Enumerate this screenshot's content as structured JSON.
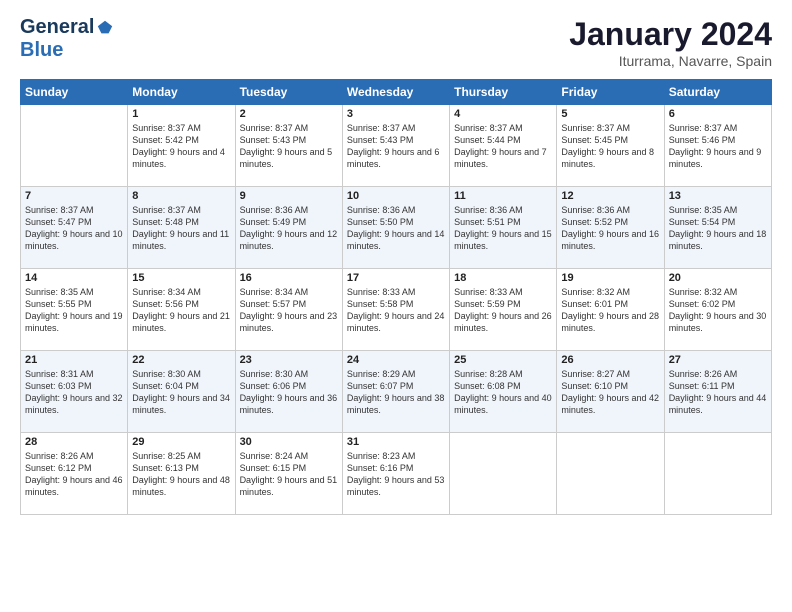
{
  "header": {
    "logo_line1": "General",
    "logo_line2": "Blue",
    "month": "January 2024",
    "location": "Iturrama, Navarre, Spain"
  },
  "weekdays": [
    "Sunday",
    "Monday",
    "Tuesday",
    "Wednesday",
    "Thursday",
    "Friday",
    "Saturday"
  ],
  "weeks": [
    [
      {
        "day": "",
        "sunrise": "",
        "sunset": "",
        "daylight": ""
      },
      {
        "day": "1",
        "sunrise": "Sunrise: 8:37 AM",
        "sunset": "Sunset: 5:42 PM",
        "daylight": "Daylight: 9 hours and 4 minutes."
      },
      {
        "day": "2",
        "sunrise": "Sunrise: 8:37 AM",
        "sunset": "Sunset: 5:43 PM",
        "daylight": "Daylight: 9 hours and 5 minutes."
      },
      {
        "day": "3",
        "sunrise": "Sunrise: 8:37 AM",
        "sunset": "Sunset: 5:43 PM",
        "daylight": "Daylight: 9 hours and 6 minutes."
      },
      {
        "day": "4",
        "sunrise": "Sunrise: 8:37 AM",
        "sunset": "Sunset: 5:44 PM",
        "daylight": "Daylight: 9 hours and 7 minutes."
      },
      {
        "day": "5",
        "sunrise": "Sunrise: 8:37 AM",
        "sunset": "Sunset: 5:45 PM",
        "daylight": "Daylight: 9 hours and 8 minutes."
      },
      {
        "day": "6",
        "sunrise": "Sunrise: 8:37 AM",
        "sunset": "Sunset: 5:46 PM",
        "daylight": "Daylight: 9 hours and 9 minutes."
      }
    ],
    [
      {
        "day": "7",
        "sunrise": "Sunrise: 8:37 AM",
        "sunset": "Sunset: 5:47 PM",
        "daylight": "Daylight: 9 hours and 10 minutes."
      },
      {
        "day": "8",
        "sunrise": "Sunrise: 8:37 AM",
        "sunset": "Sunset: 5:48 PM",
        "daylight": "Daylight: 9 hours and 11 minutes."
      },
      {
        "day": "9",
        "sunrise": "Sunrise: 8:36 AM",
        "sunset": "Sunset: 5:49 PM",
        "daylight": "Daylight: 9 hours and 12 minutes."
      },
      {
        "day": "10",
        "sunrise": "Sunrise: 8:36 AM",
        "sunset": "Sunset: 5:50 PM",
        "daylight": "Daylight: 9 hours and 14 minutes."
      },
      {
        "day": "11",
        "sunrise": "Sunrise: 8:36 AM",
        "sunset": "Sunset: 5:51 PM",
        "daylight": "Daylight: 9 hours and 15 minutes."
      },
      {
        "day": "12",
        "sunrise": "Sunrise: 8:36 AM",
        "sunset": "Sunset: 5:52 PM",
        "daylight": "Daylight: 9 hours and 16 minutes."
      },
      {
        "day": "13",
        "sunrise": "Sunrise: 8:35 AM",
        "sunset": "Sunset: 5:54 PM",
        "daylight": "Daylight: 9 hours and 18 minutes."
      }
    ],
    [
      {
        "day": "14",
        "sunrise": "Sunrise: 8:35 AM",
        "sunset": "Sunset: 5:55 PM",
        "daylight": "Daylight: 9 hours and 19 minutes."
      },
      {
        "day": "15",
        "sunrise": "Sunrise: 8:34 AM",
        "sunset": "Sunset: 5:56 PM",
        "daylight": "Daylight: 9 hours and 21 minutes."
      },
      {
        "day": "16",
        "sunrise": "Sunrise: 8:34 AM",
        "sunset": "Sunset: 5:57 PM",
        "daylight": "Daylight: 9 hours and 23 minutes."
      },
      {
        "day": "17",
        "sunrise": "Sunrise: 8:33 AM",
        "sunset": "Sunset: 5:58 PM",
        "daylight": "Daylight: 9 hours and 24 minutes."
      },
      {
        "day": "18",
        "sunrise": "Sunrise: 8:33 AM",
        "sunset": "Sunset: 5:59 PM",
        "daylight": "Daylight: 9 hours and 26 minutes."
      },
      {
        "day": "19",
        "sunrise": "Sunrise: 8:32 AM",
        "sunset": "Sunset: 6:01 PM",
        "daylight": "Daylight: 9 hours and 28 minutes."
      },
      {
        "day": "20",
        "sunrise": "Sunrise: 8:32 AM",
        "sunset": "Sunset: 6:02 PM",
        "daylight": "Daylight: 9 hours and 30 minutes."
      }
    ],
    [
      {
        "day": "21",
        "sunrise": "Sunrise: 8:31 AM",
        "sunset": "Sunset: 6:03 PM",
        "daylight": "Daylight: 9 hours and 32 minutes."
      },
      {
        "day": "22",
        "sunrise": "Sunrise: 8:30 AM",
        "sunset": "Sunset: 6:04 PM",
        "daylight": "Daylight: 9 hours and 34 minutes."
      },
      {
        "day": "23",
        "sunrise": "Sunrise: 8:30 AM",
        "sunset": "Sunset: 6:06 PM",
        "daylight": "Daylight: 9 hours and 36 minutes."
      },
      {
        "day": "24",
        "sunrise": "Sunrise: 8:29 AM",
        "sunset": "Sunset: 6:07 PM",
        "daylight": "Daylight: 9 hours and 38 minutes."
      },
      {
        "day": "25",
        "sunrise": "Sunrise: 8:28 AM",
        "sunset": "Sunset: 6:08 PM",
        "daylight": "Daylight: 9 hours and 40 minutes."
      },
      {
        "day": "26",
        "sunrise": "Sunrise: 8:27 AM",
        "sunset": "Sunset: 6:10 PM",
        "daylight": "Daylight: 9 hours and 42 minutes."
      },
      {
        "day": "27",
        "sunrise": "Sunrise: 8:26 AM",
        "sunset": "Sunset: 6:11 PM",
        "daylight": "Daylight: 9 hours and 44 minutes."
      }
    ],
    [
      {
        "day": "28",
        "sunrise": "Sunrise: 8:26 AM",
        "sunset": "Sunset: 6:12 PM",
        "daylight": "Daylight: 9 hours and 46 minutes."
      },
      {
        "day": "29",
        "sunrise": "Sunrise: 8:25 AM",
        "sunset": "Sunset: 6:13 PM",
        "daylight": "Daylight: 9 hours and 48 minutes."
      },
      {
        "day": "30",
        "sunrise": "Sunrise: 8:24 AM",
        "sunset": "Sunset: 6:15 PM",
        "daylight": "Daylight: 9 hours and 51 minutes."
      },
      {
        "day": "31",
        "sunrise": "Sunrise: 8:23 AM",
        "sunset": "Sunset: 6:16 PM",
        "daylight": "Daylight: 9 hours and 53 minutes."
      },
      {
        "day": "",
        "sunrise": "",
        "sunset": "",
        "daylight": ""
      },
      {
        "day": "",
        "sunrise": "",
        "sunset": "",
        "daylight": ""
      },
      {
        "day": "",
        "sunrise": "",
        "sunset": "",
        "daylight": ""
      }
    ]
  ]
}
